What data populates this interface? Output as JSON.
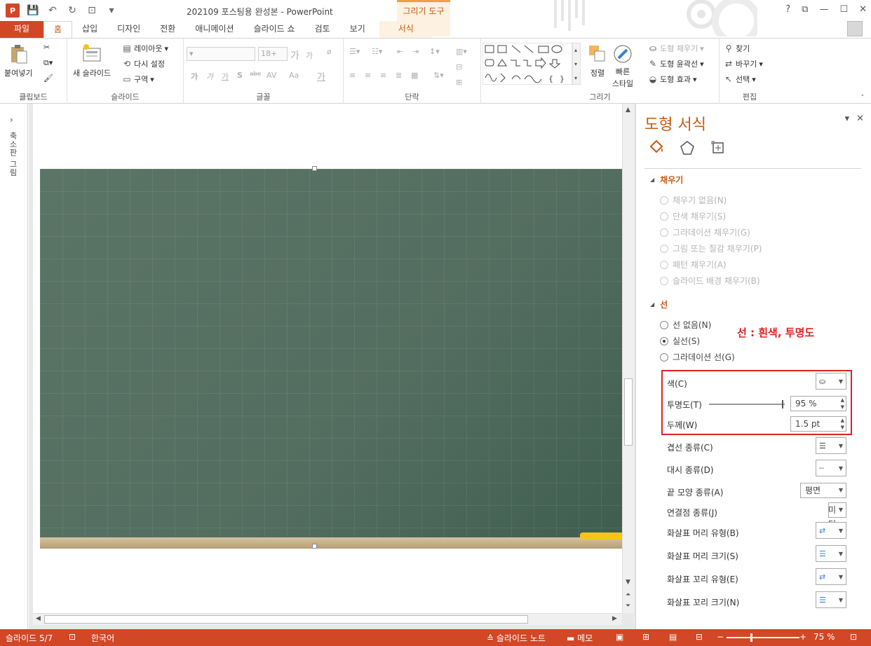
{
  "title_bar": {
    "doc_title": "202109 포스팅용 완성본 - PowerPoint",
    "contextual_tab": "그리기 도구",
    "help": "?",
    "ribbon_display": "⧉",
    "minimize": "—",
    "maximize": "☐",
    "close": "✕"
  },
  "tabs": [
    "파일",
    "홈",
    "삽입",
    "디자인",
    "전환",
    "애니메이션",
    "슬라이드 쇼",
    "검토",
    "보기",
    "서식"
  ],
  "ribbon": {
    "clipboard": {
      "paste": "붙여넣기",
      "label": "클립보드"
    },
    "slides": {
      "new_slide": "새 슬라이드",
      "layout": "레이아웃",
      "reset": "다시 설정",
      "section": "구역",
      "label": "슬라이드"
    },
    "font": {
      "size": "18+",
      "label": "글꼴",
      "bold": "가",
      "italic": "가",
      "underline": "가",
      "shadow": "S",
      "strike": "abc",
      "spacing": "AV",
      "case": "Aa",
      "color": "가",
      "grow": "가",
      "shrink": "가"
    },
    "paragraph": {
      "label": "단락"
    },
    "drawing": {
      "arrange": "정렬",
      "quick_style_1": "빠른",
      "quick_style_2": "스타일",
      "shape_fill": "도형 채우기",
      "shape_outline": "도형 윤곽선",
      "shape_effect": "도형 효과",
      "label": "그리기"
    },
    "editing": {
      "find": "찾기",
      "replace": "바꾸기",
      "select": "선택",
      "label": "편집"
    }
  },
  "left_pane": {
    "label": "축소판 그림"
  },
  "format_pane": {
    "title": "도형 서식",
    "fill_section": "채우기",
    "fill_options": [
      "채우기 없음(N)",
      "단색 채우기(S)",
      "그라데이션 채우기(G)",
      "그림 또는 질감 채우기(P)",
      "패턴 채우기(A)",
      "슬라이드 배경 채우기(B)"
    ],
    "line_section": "선",
    "line_options": [
      "선 없음(N)",
      "실선(S)",
      "그라데이션 선(G)"
    ],
    "annotation": "선 : 흰색, 투명도",
    "color_label": "색(C)",
    "transparency_label": "투명도(T)",
    "transparency_value": "95 %",
    "width_label": "두께(W)",
    "width_value": "1.5 pt",
    "compound_label": "겹선 종류(C)",
    "dash_label": "대시 종류(D)",
    "cap_label": "끝 모양 종류(A)",
    "cap_value": "평면",
    "join_label": "연결점 종류(J)",
    "join_value": "미터",
    "begin_arrow_type": "화살표 머리 유형(B)",
    "begin_arrow_size": "화살표 머리 크기(S)",
    "end_arrow_type": "화살표 꼬리 유형(E)",
    "end_arrow_size": "화살표 꼬리 크기(N)"
  },
  "status_bar": {
    "slide": "슬라이드 5/7",
    "language": "한국어",
    "notes": "슬라이드 노트",
    "comments": "메모",
    "zoom": "75 %"
  },
  "colors": {
    "accent": "#d24726",
    "pane_title": "#c55a11",
    "annotation": "#e02020",
    "board": "#536e60"
  }
}
